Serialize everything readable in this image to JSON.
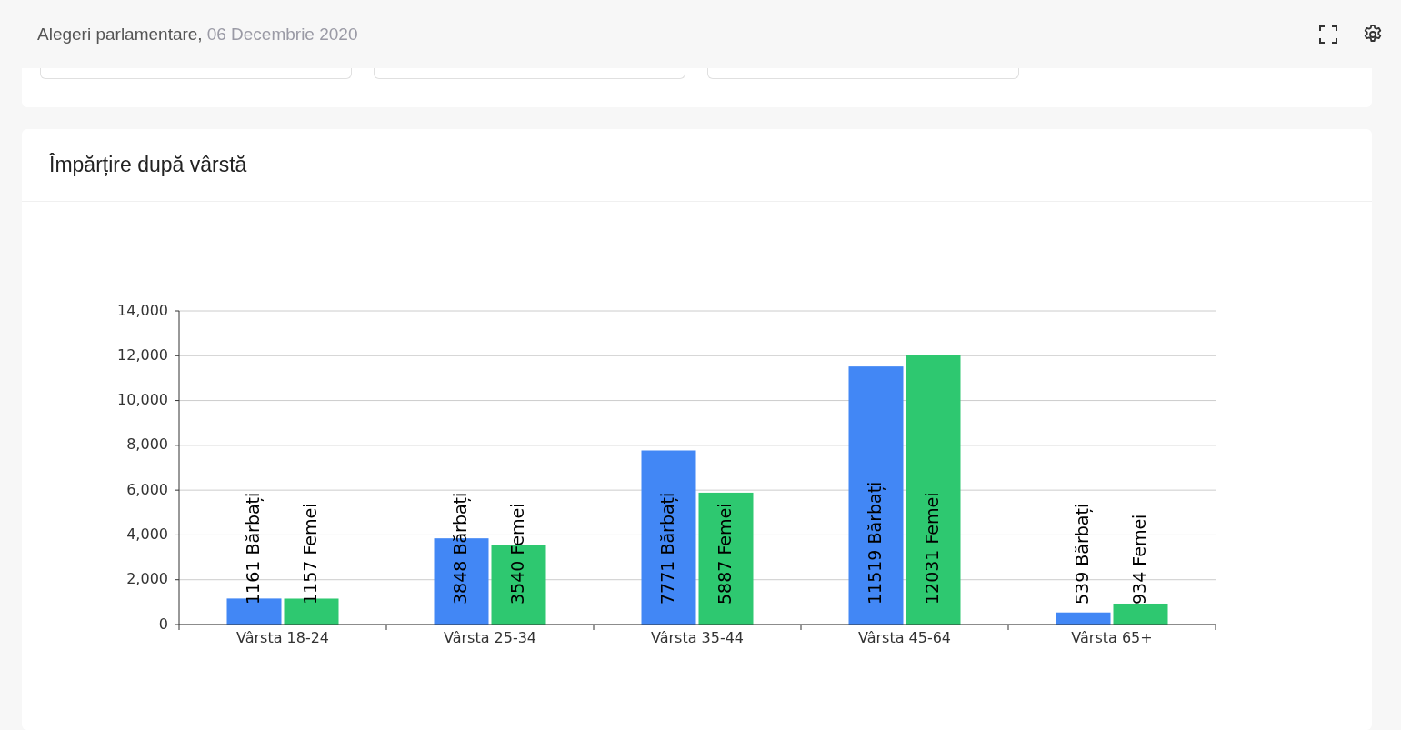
{
  "header": {
    "title": "Alegeri parlamentare",
    "separator": ",",
    "date": "06 Decembrie 2020"
  },
  "age_panel": {
    "title": "Împărțire după vârstă",
    "chart_data": {
      "type": "bar",
      "categories": [
        "Vârsta 18-24",
        "Vârsta 25-34",
        "Vârsta 35-44",
        "Vârsta 45-64",
        "Vârsta 65+"
      ],
      "series": [
        {
          "color": "#4287f5",
          "values": [
            1161,
            3848,
            7771,
            11519,
            539
          ],
          "value_labels": [
            "1161 Bărbați",
            "3848 Bărbați",
            "7771 Bărbați",
            "11519 Bărbați",
            "539 Bărbați"
          ]
        },
        {
          "color": "#2ec870",
          "values": [
            1157,
            3540,
            5887,
            12031,
            934
          ],
          "value_labels": [
            "1157 Femei",
            "3540 Femei",
            "5887 Femei",
            "12031 Femei",
            "934 Femei"
          ]
        }
      ],
      "ylim": [
        0,
        14000
      ],
      "yticks": [
        {
          "value": 0,
          "label": "0"
        },
        {
          "value": 2000,
          "label": "2,000"
        },
        {
          "value": 4000,
          "label": "4,000"
        },
        {
          "value": 6000,
          "label": "6,000"
        },
        {
          "value": 8000,
          "label": "8,000"
        },
        {
          "value": 10000,
          "label": "10,000"
        },
        {
          "value": 12000,
          "label": "12,000"
        },
        {
          "value": 14000,
          "label": "14,000"
        }
      ],
      "grid": true
    }
  }
}
